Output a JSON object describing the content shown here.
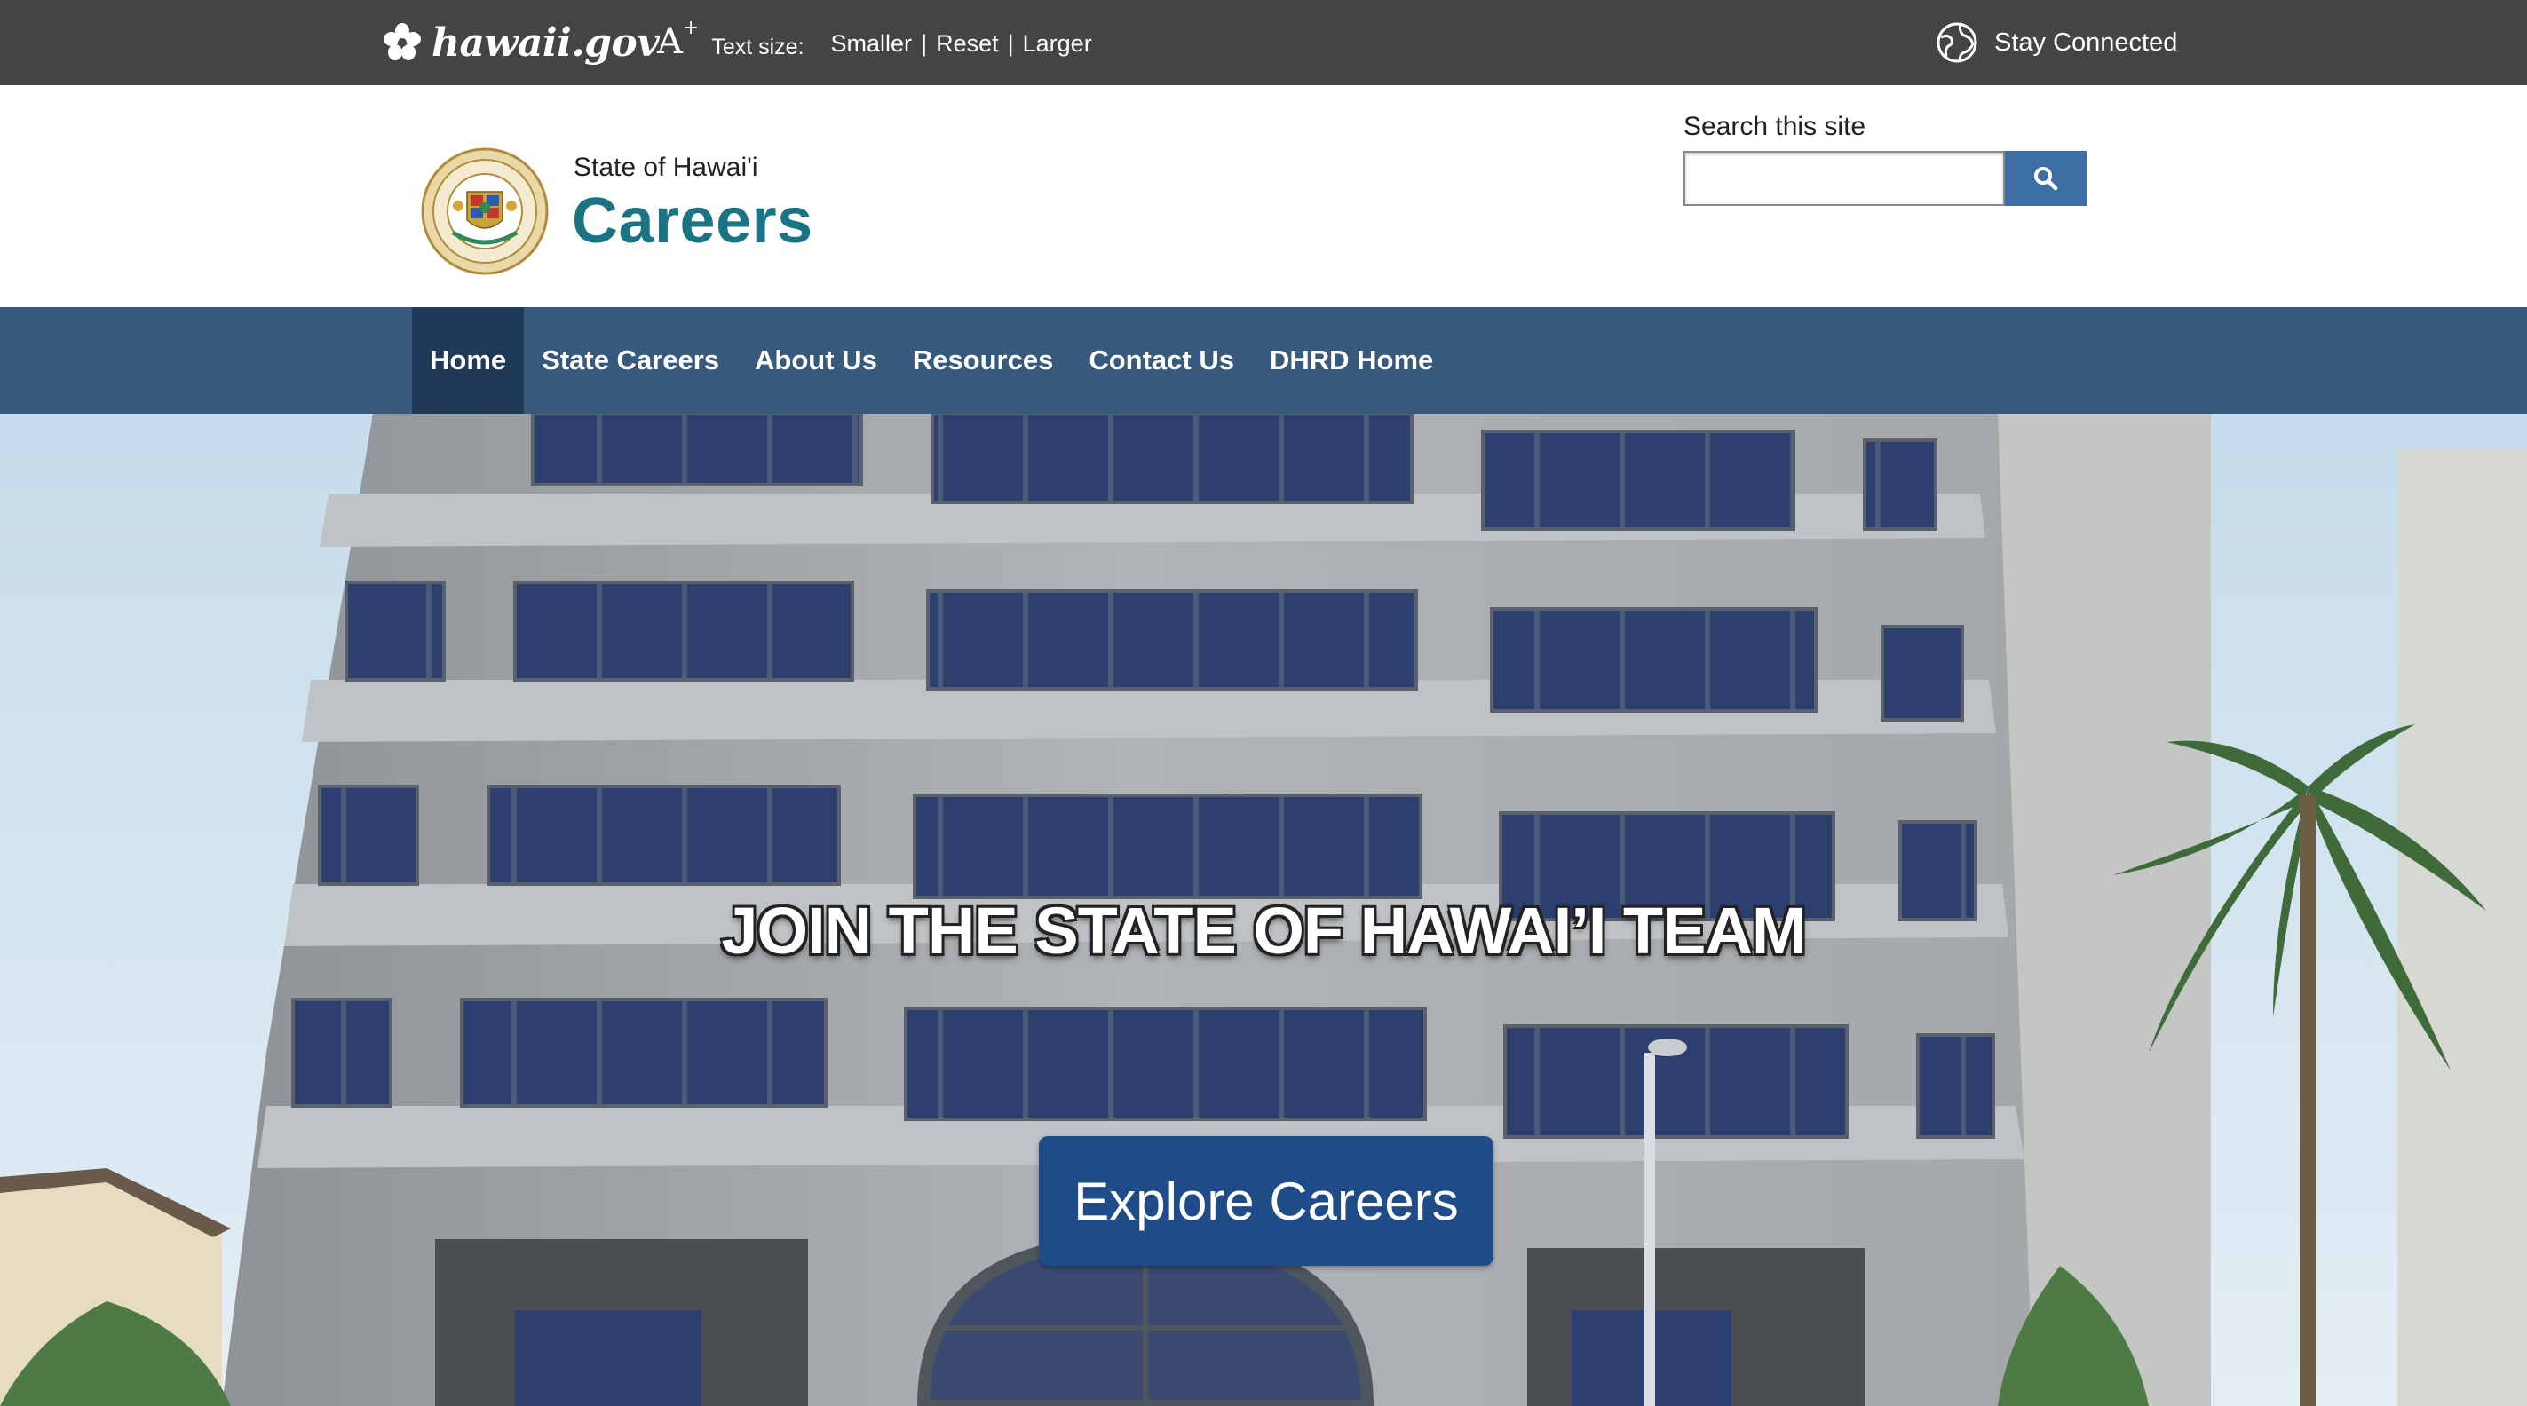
{
  "topbar": {
    "logo_text": "hawaii.gov",
    "text_size_label": "Text size:",
    "text_size_options": [
      "Smaller",
      "Reset",
      "Larger"
    ],
    "stay_connected": "Stay Connected"
  },
  "header": {
    "state_name": "State of Hawai'i",
    "site_title": "Careers",
    "search": {
      "label": "Search this site",
      "value": "",
      "placeholder": ""
    }
  },
  "nav": {
    "items": [
      "Home",
      "State Careers",
      "About Us",
      "Resources",
      "Contact Us",
      "DHRD Home"
    ],
    "active": "Home"
  },
  "hero": {
    "headline": "JOIN THE STATE OF HAWAI’I TEAM",
    "cta_label": "Explore Careers"
  },
  "colors": {
    "topbar": "#444444",
    "nav": "#36597c",
    "nav_active": "#1f3a56",
    "title": "#1a7484",
    "search_button": "#3d6ea3",
    "cta": "#1f4b86"
  },
  "icons": [
    "hibiscus-icon",
    "text-size-icon",
    "globe-icon",
    "state-seal",
    "search-icon"
  ]
}
